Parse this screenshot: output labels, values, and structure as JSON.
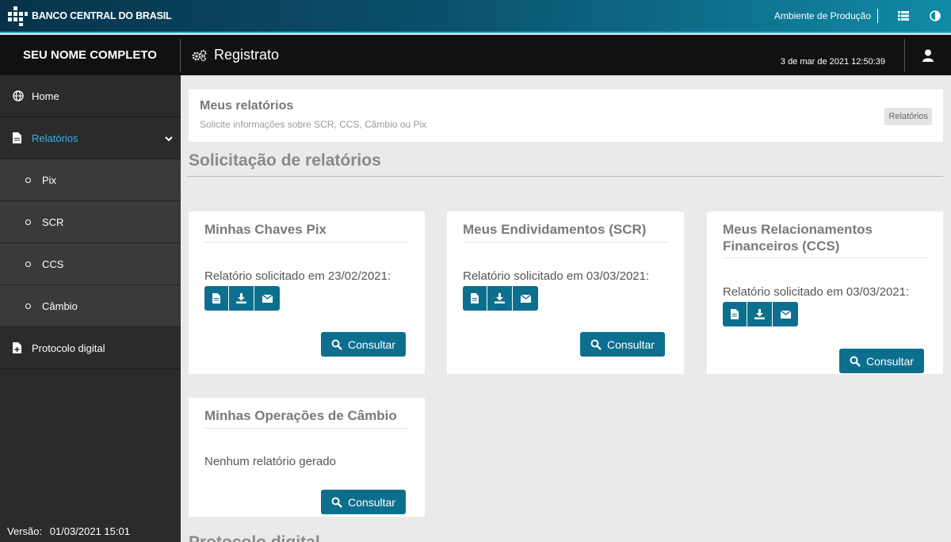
{
  "topbar": {
    "brand": "BANCO CENTRAL DO BRASIL",
    "environment": "Ambiente de Produção",
    "icons": [
      "list-icon",
      "contrast-icon"
    ]
  },
  "secondbar": {
    "user_name": "SEU NOME COMPLETO",
    "app_title": "Registrato",
    "datetime": "3 de mar de 2021 12:50:39"
  },
  "sidebar": {
    "items": [
      {
        "label": "Home",
        "icon": "globe-icon"
      },
      {
        "label": "Relatórios",
        "icon": "file-icon"
      },
      {
        "label": "Protocolo digital",
        "icon": "file-plus-icon"
      }
    ],
    "subitems": [
      {
        "label": "Pix"
      },
      {
        "label": "SCR"
      },
      {
        "label": "CCS"
      },
      {
        "label": "Câmbio"
      }
    ],
    "version_label": "Versão:",
    "version_value": "01/03/2021 15:01"
  },
  "header": {
    "title": "Meus relatórios",
    "subtitle": "Solicite informações sobre SCR, CCS, Câmbio ou Pix",
    "breadcrumb": "Relatórios"
  },
  "main": {
    "section_title": "Solicitação de relatórios",
    "section_title_2": "Protocolo digital",
    "consult_label": "Consultar",
    "cards": [
      {
        "title": "Minhas Chaves Pix",
        "text": "Relatório solicitado em 23/02/2021:"
      },
      {
        "title": "Meus Endividamentos (SCR)",
        "text": "Relatório solicitado em 03/03/2021:"
      },
      {
        "title_line1": "Meus Relacionamentos",
        "title_line2": "Financeiros (CCS)",
        "text": "Relatório solicitado em 03/03/2021:"
      },
      {
        "title": "Minhas Operações de Câmbio",
        "text": "Nenhum relatório gerado"
      }
    ]
  },
  "colors": {
    "accent": "#0d6f8e",
    "active_link": "#3ab0e8",
    "sidebar_bg": "#2b2b2b"
  }
}
